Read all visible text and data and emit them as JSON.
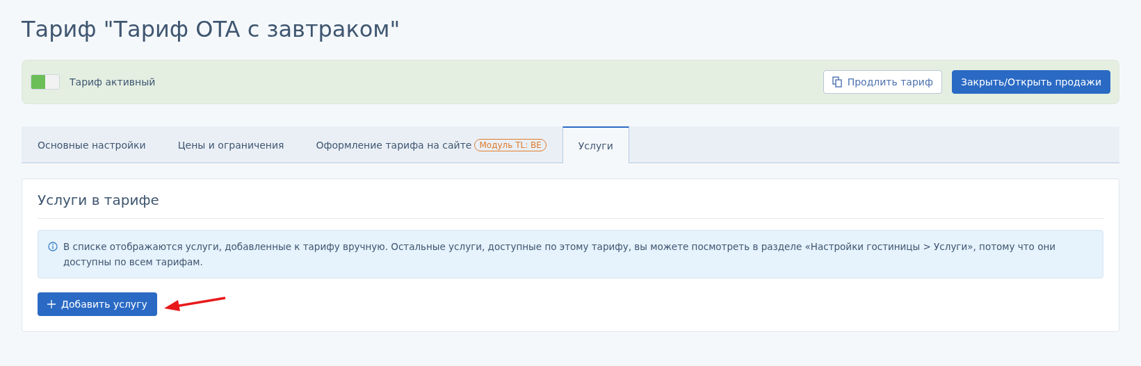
{
  "title": "Тариф \"Тариф OTA с завтраком\"",
  "status_bar": {
    "toggle": {
      "on": true
    },
    "label": "Тариф активный",
    "buttons": [
      {
        "kind": "secondary",
        "label": "Продлить тариф"
      },
      {
        "kind": "primary",
        "label": "Закрыть/Открыть продажи"
      }
    ]
  },
  "tabs": [
    {
      "label": "Основные настройки",
      "selected": false
    },
    {
      "label": "Цены и ограничения",
      "selected": false
    },
    {
      "label": "Оформление тарифа на сайте",
      "badge": "Модуль TL: BE",
      "selected": false
    },
    {
      "label": "Услуги",
      "selected": true
    }
  ],
  "panel": {
    "heading": "Услуги в тарифе",
    "info": "В списке отображаются услуги, добавленные к тарифу вручную. Остальные услуги, доступные по этому тарифу, вы можете посмотреть в разделе «Настройки гостиницы > Услуги», потому что они доступны по всем тарифам.",
    "add_button": "Добавить услугу"
  }
}
